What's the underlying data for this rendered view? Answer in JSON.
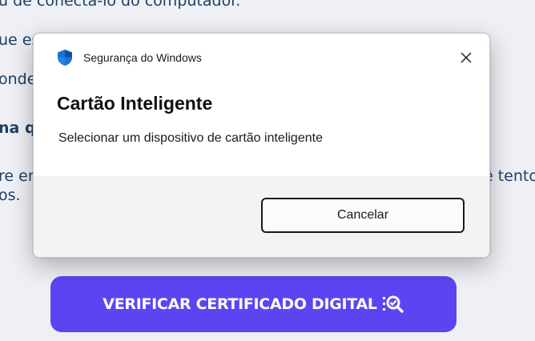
{
  "background": {
    "lines": [
      "u de conectá-lo do computador.",
      "ue es",
      "onde",
      "na q",
      "re en",
      "os.",
      "ê tento"
    ],
    "verify_button": "VERIFICAR CERTIFICADO DIGITAL",
    "verify_icon": "search-check-icon",
    "accent_color": "#5b45f2"
  },
  "dialog": {
    "header_title": "Segurança do Windows",
    "header_icon": "shield-icon",
    "close_icon": "close-icon",
    "title": "Cartão Inteligente",
    "description": "Selecionar um dispositivo de cartão inteligente",
    "cancel_label": "Cancelar"
  }
}
